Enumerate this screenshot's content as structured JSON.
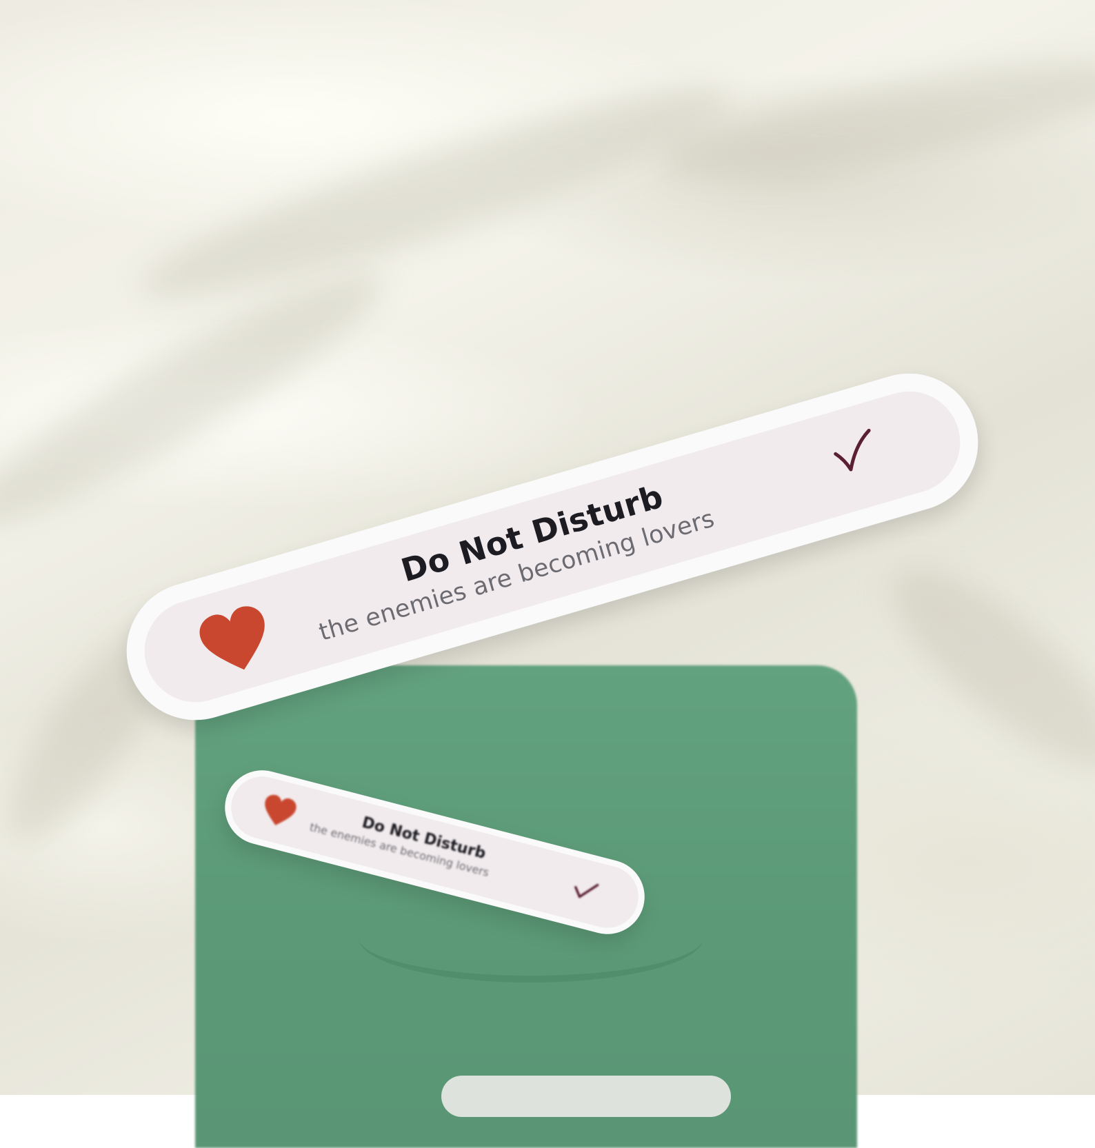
{
  "scene": {
    "background": "cream fleece blanket",
    "device": "green e-reader cover"
  },
  "sticker_large": {
    "title": "Do Not Disturb",
    "subtitle": "the enemies are becoming lovers",
    "left_icon": "heart-icon",
    "right_icon": "checkmark-icon"
  },
  "sticker_small": {
    "title": "Do Not Disturb",
    "subtitle": "the enemies are becoming lovers",
    "left_icon": "heart-icon",
    "right_icon": "checkmark-icon"
  },
  "colors": {
    "blanket": "#eeece2",
    "device_green": "#5f9d79",
    "sticker_border": "#fafafa",
    "sticker_face": "#f1ebed",
    "heart": "#c9472f",
    "checkmark": "#5a1f32",
    "title_text": "#1d1c22",
    "subtitle_text": "#6d6b72"
  }
}
